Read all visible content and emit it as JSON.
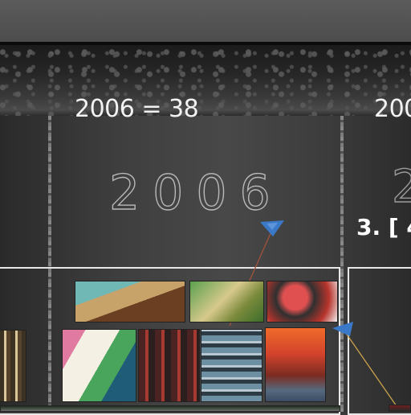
{
  "headings": {
    "main": "2006 = 38",
    "next_partial": "200"
  },
  "chalk": {
    "main_year": "2006",
    "next_partial": "2"
  },
  "rank": {
    "label": "3. [ 4"
  },
  "colors": {
    "frame": "#e8e8e8",
    "pin": "#3a78c8",
    "thread_red": "#a0523a",
    "thread_yellow": "#c9a24a"
  }
}
